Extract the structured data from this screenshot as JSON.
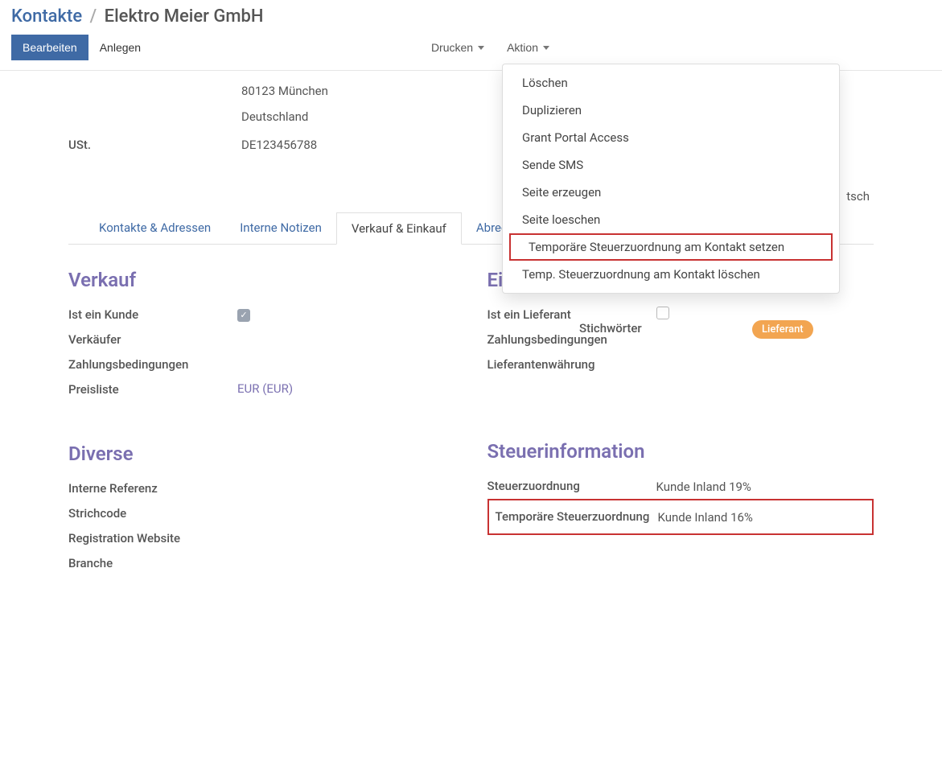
{
  "breadcrumb": {
    "parent": "Kontakte",
    "current": "Elektro Meier GmbH"
  },
  "toolbar": {
    "edit": "Bearbeiten",
    "create": "Anlegen",
    "print": "Drucken",
    "action": "Aktion"
  },
  "action_menu": [
    "Löschen",
    "Duplizieren",
    "Grant Portal Access",
    "Sende SMS",
    "Seite erzeugen",
    "Seite loeschen",
    "Temporäre Steuerzuordnung am Kontakt setzen",
    "Temp. Steuerzuordnung am Kontakt löschen"
  ],
  "address": {
    "line1": "80123  München",
    "line2": "Deutschland"
  },
  "fields": {
    "ust_label": "USt.",
    "ust_value": "DE123456788"
  },
  "right_peek": "tsch",
  "side_labels": {
    "stichwoerter": "Stichwörter"
  },
  "badge": "Lieferant",
  "tabs": {
    "contacts": "Kontakte & Adressen",
    "notes": "Interne Notizen",
    "sales": "Verkauf & Einkauf",
    "billing": "Abrechnung"
  },
  "verkauf": {
    "title": "Verkauf",
    "is_customer": "Ist ein Kunde",
    "salesperson": "Verkäufer",
    "payment_terms": "Zahlungsbedingungen",
    "pricelist": "Preisliste",
    "pricelist_value": "EUR (EUR)"
  },
  "einkauf": {
    "title": "Einkauf",
    "is_supplier": "Ist ein Lieferant",
    "payment_terms": "Zahlungsbedingungen",
    "currency": "Lieferantenwährung"
  },
  "diverse": {
    "title": "Diverse",
    "ref": "Interne Referenz",
    "barcode": "Strichcode",
    "reg_site": "Registration Website",
    "industry": "Branche"
  },
  "steuer": {
    "title": "Steuerinformation",
    "mapping_label": "Steuerzuordnung",
    "mapping_value": "Kunde Inland 19%",
    "temp_label": "Temporäre Steuerzuordnung",
    "temp_value": "Kunde Inland 16%"
  }
}
